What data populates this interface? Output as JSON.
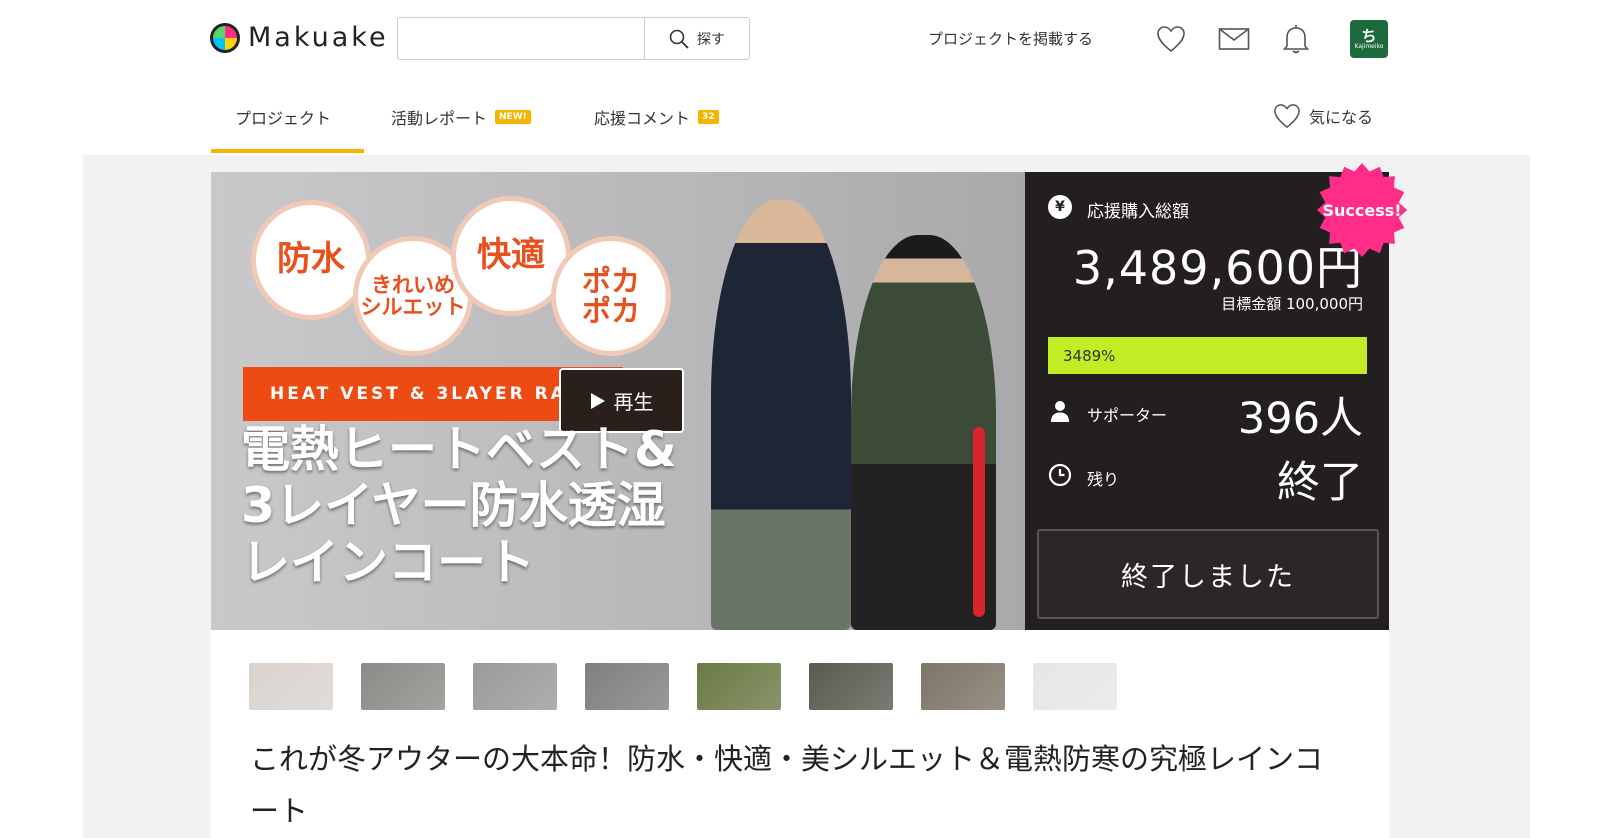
{
  "header": {
    "logo_text": "Makuake",
    "search_placeholder": "",
    "search_button": "探す",
    "post_project": "プロジェクトを掲載する",
    "avatar_label": "Kajimeiko"
  },
  "tabs": [
    {
      "label": "プロジェクト"
    },
    {
      "label": "活動レポート",
      "badge": "NEW!"
    },
    {
      "label": "応援コメント",
      "badge": "32"
    }
  ],
  "favorite_label": "気になる",
  "hero": {
    "bubbles": [
      "防水",
      "きれいめ\nシルエット",
      "快適",
      "ポカ\nポカ"
    ],
    "strip_text": "HEAT VEST & 3LAYER RAINCOAT",
    "play_label": "再生",
    "title_line1": "電熱ヒートベスト&",
    "title_line2": "3レイヤー防水透湿",
    "title_line3": "レインコート"
  },
  "panel": {
    "success_badge": "Success!",
    "currency_symbol": "¥",
    "total_label": "応援購入総額",
    "total_amount": "3,489,600円",
    "goal_text": "目標金額 100,000円",
    "progress_percent": "3489%",
    "progress_fraction": 1.0,
    "supporters_label": "サポーター",
    "supporters_value": "396人",
    "remaining_label": "残り",
    "remaining_value": "終了",
    "ended_button": "終了しました"
  },
  "thumbnails": [
    {
      "color": "#d9d3cf"
    },
    {
      "color": "#8b8c88"
    },
    {
      "color": "#9a9a9c"
    },
    {
      "color": "#7e7f80"
    },
    {
      "color": "#6b7a45"
    },
    {
      "color": "#5b5a50"
    },
    {
      "color": "#7d7566"
    },
    {
      "color": "#e6e6e8"
    }
  ],
  "page_title": "これが冬アウターの大本命！防水・快適・美シルエット＆電熱防寒の究極レインコート",
  "colors": {
    "accent": "#f5b400",
    "progress": "#c2ed24",
    "success": "#ff2d87",
    "panel_bg": "#231f20"
  }
}
